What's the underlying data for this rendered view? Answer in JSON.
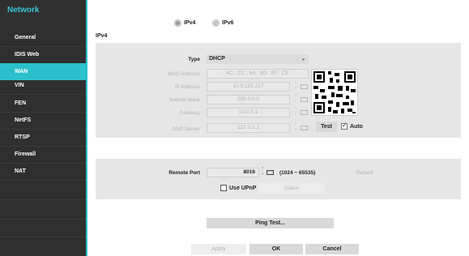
{
  "sidebar": {
    "title": "Network",
    "items": [
      {
        "label": "General"
      },
      {
        "label": "IDIS Web"
      },
      {
        "label": "WAN"
      },
      {
        "label": "VIN"
      },
      {
        "label": "FEN"
      },
      {
        "label": "NetFS"
      },
      {
        "label": "RTSP"
      },
      {
        "label": "Firewall"
      },
      {
        "label": "NAT"
      }
    ],
    "active_item": "WAN",
    "accent_color": "#2bc0cc"
  },
  "ip_version": {
    "ipv4_label": "IPv4",
    "ipv6_label": "IPv6",
    "selected": "IPv4"
  },
  "section_title": "IPv4",
  "form": {
    "type_label": "Type",
    "type_value": "DHCP",
    "mac_label": "MAC Address",
    "mac_value": "4C : CC : 6A : 8D : 8F : CE",
    "ip_label": "IP Address",
    "ip_value": "10.0.125.217",
    "subnet_label": "Subnet Mask",
    "subnet_value": "255.0.0.0",
    "gateway_label": "Gateway",
    "gateway_value": "10.0.0.1",
    "dns_label": "DNS Server",
    "dns_value": "127.0.1.1",
    "test_label": "Test",
    "auto_label": "Auto",
    "auto_checked": true
  },
  "remote": {
    "port_label": "Remote Port",
    "port_value": "8016",
    "port_range": "(1024 ~ 65535)",
    "default_label": "Default",
    "upnp_label": "Use UPnP",
    "upnp_checked": false,
    "status_label": "Status"
  },
  "ping_test_label": "Ping Test...",
  "footer": {
    "apply_label": "Apply",
    "ok_label": "OK",
    "cancel_label": "Cancel"
  }
}
